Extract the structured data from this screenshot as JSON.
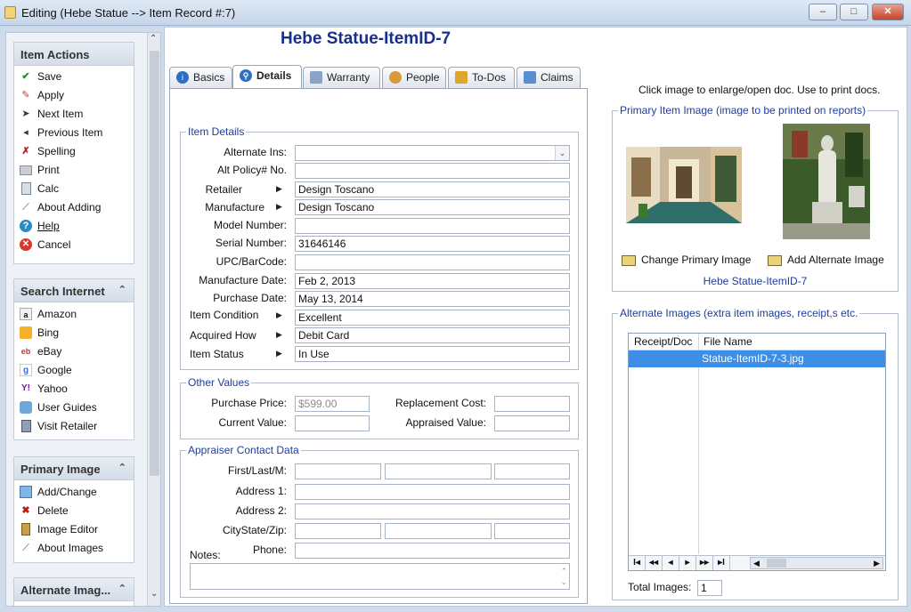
{
  "window": {
    "title": "Editing  (Hebe Statue --> Item Record #:7)",
    "minimize_label": "–",
    "maximize_label": "□",
    "close_label": "✕"
  },
  "sidebar": {
    "item_actions": {
      "title": "Item Actions",
      "items": [
        {
          "label": "Save",
          "icon": "checkmark-icon"
        },
        {
          "label": "Apply",
          "icon": "apply-icon"
        },
        {
          "label": "Next Item",
          "icon": "next-arrow-icon"
        },
        {
          "label": "Previous Item",
          "icon": "previous-arrow-icon"
        },
        {
          "label": "Spelling",
          "icon": "spelling-icon"
        },
        {
          "label": "Print",
          "icon": "printer-icon"
        },
        {
          "label": "Calc",
          "icon": "calculator-icon"
        },
        {
          "label": "About Adding",
          "icon": "wand-icon"
        },
        {
          "label": "Help",
          "icon": "help-icon"
        },
        {
          "label": "Cancel",
          "icon": "cancel-icon"
        }
      ]
    },
    "search_internet": {
      "title": "Search Internet",
      "items": [
        {
          "label": "Amazon",
          "icon": "amazon-icon"
        },
        {
          "label": "Bing",
          "icon": "bing-icon"
        },
        {
          "label": "eBay",
          "icon": "ebay-icon"
        },
        {
          "label": "Google",
          "icon": "google-icon"
        },
        {
          "label": "Yahoo",
          "icon": "yahoo-icon"
        },
        {
          "label": "User Guides",
          "icon": "user-guides-icon"
        },
        {
          "label": "Visit Retailer",
          "icon": "retailer-icon"
        }
      ]
    },
    "primary_image": {
      "title": "Primary Image",
      "items": [
        {
          "label": "Add/Change",
          "icon": "add-image-icon"
        },
        {
          "label": "Delete",
          "icon": "delete-icon"
        },
        {
          "label": "Image Editor",
          "icon": "image-editor-icon"
        },
        {
          "label": "About Images",
          "icon": "wand-icon"
        }
      ]
    },
    "alternate_images": {
      "title": "Alternate Imag..."
    }
  },
  "record_title": "Hebe Statue-ItemID-7",
  "tabs": [
    {
      "label": "Basics",
      "icon": "info-icon"
    },
    {
      "label": "Details",
      "icon": "search-icon"
    },
    {
      "label": "Warranty",
      "icon": "warranty-icon"
    },
    {
      "label": "People",
      "icon": "people-icon"
    },
    {
      "label": "To-Dos",
      "icon": "todo-icon"
    },
    {
      "label": "Claims",
      "icon": "claims-icon"
    }
  ],
  "item_details": {
    "title": "Item Details",
    "alternate_ins_label": "Alternate Ins:",
    "alternate_ins_value": "",
    "alt_policy_label": "Alt Policy# No.",
    "alt_policy_value": "",
    "retailer_label": "Retailer",
    "retailer_value": "Design Toscano",
    "manufacture_label": "Manufacture",
    "manufacture_value": "Design Toscano",
    "model_label": "Model Number:",
    "model_value": "",
    "serial_label": "Serial Number:",
    "serial_value": "31646146",
    "upc_label": "UPC/BarCode:",
    "upc_value": "",
    "mfg_date_label": "Manufacture Date:",
    "mfg_date_value": "Feb 2, 2013",
    "purchase_date_label": "Purchase Date:",
    "purchase_date_value": "May 13, 2014",
    "condition_label": "Item Condition",
    "condition_value": "Excellent",
    "acquired_label": "Acquired How",
    "acquired_value": "Debit Card",
    "status_label": "Item Status",
    "status_value": "In Use"
  },
  "other_values": {
    "title": "Other Values",
    "purchase_price_label": "Purchase Price:",
    "purchase_price_value": "$599.00",
    "replacement_cost_label": "Replacement Cost:",
    "replacement_cost_value": "",
    "current_value_label": "Current Value:",
    "current_value_value": "",
    "appraised_value_label": "Appraised Value:",
    "appraised_value_value": ""
  },
  "appraiser": {
    "title": "Appraiser Contact Data",
    "name_label": "First/Last/M:",
    "address1_label": "Address 1:",
    "address2_label": "Address 2:",
    "citystatezip_label": "CityState/Zip:",
    "phone_label": "Phone:",
    "notes_label": "Notes:"
  },
  "right_pane": {
    "hint": "Click image to enlarge/open doc. Use to print docs.",
    "primary_group_title": "Primary Item Image (image to be printed on reports)",
    "change_primary_label": "Change Primary Image",
    "add_alternate_label": "Add Alternate Image",
    "primary_caption": "Hebe Statue-ItemID-7",
    "alternate_group_title": "Alternate Images (extra item images, receipt,s etc.",
    "grid_headers": [
      "Receipt/Doc",
      "File Name"
    ],
    "grid_rows": [
      {
        "receipt": "",
        "file_name": "Statue-ItemID-7-3.jpg"
      }
    ],
    "total_images_label": "Total Images:",
    "total_images_value": "1",
    "nav_buttons": [
      "I◂",
      "◂◂",
      "◂",
      "▸",
      "▸▸",
      "▸I"
    ]
  }
}
